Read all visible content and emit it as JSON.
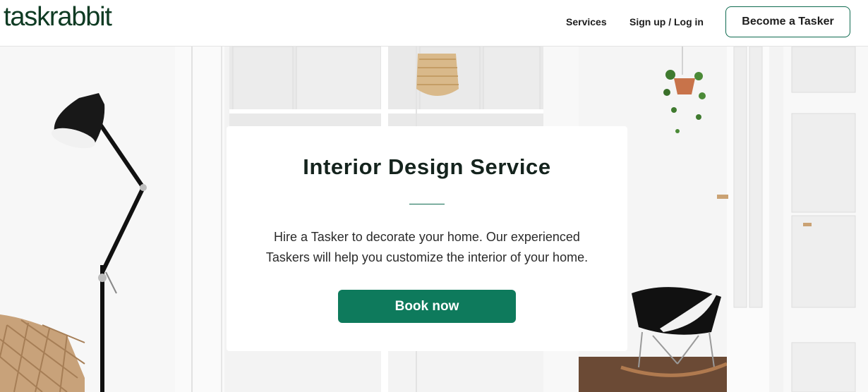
{
  "header": {
    "logo": "taskrabbit",
    "nav": {
      "services": "Services",
      "signup_login": "Sign up / Log in"
    },
    "cta": "Become a Tasker"
  },
  "hero": {
    "card": {
      "title": "Interior Design Service",
      "description": "Hire a Tasker to decorate your home. Our experienced Taskers will help you customize the interior of your home.",
      "button": "Book now"
    }
  },
  "colors": {
    "brand_dark_green": "#0f3b23",
    "button_green": "#0e7a5c"
  }
}
